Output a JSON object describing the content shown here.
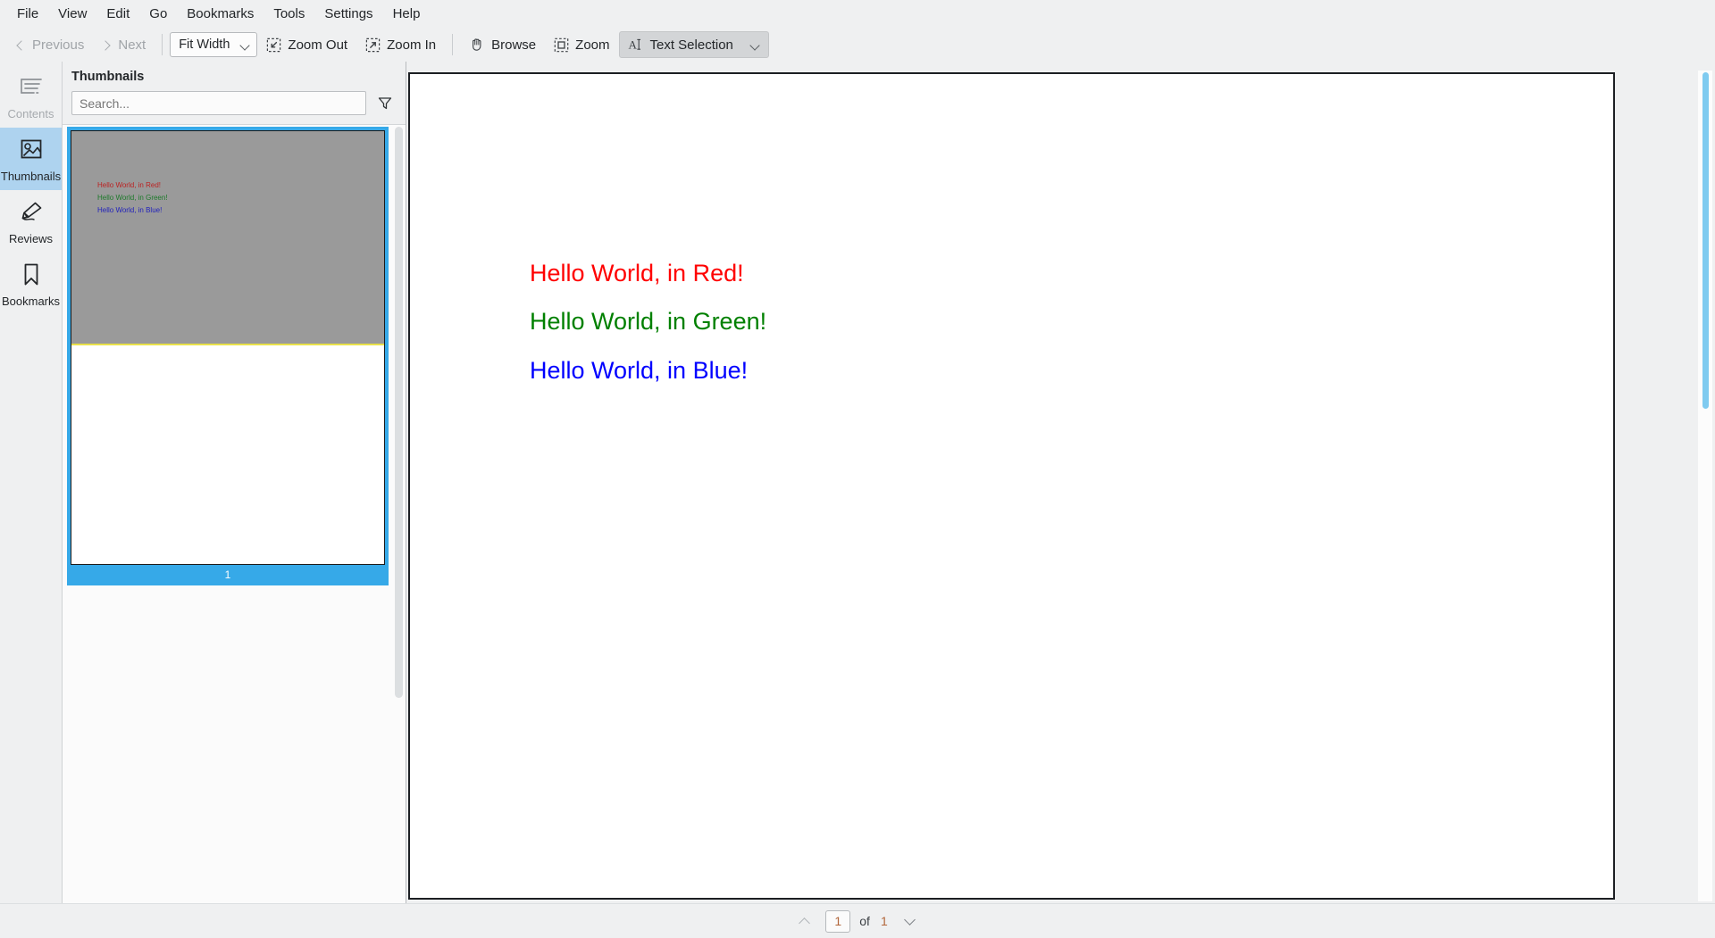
{
  "menubar": {
    "items": [
      {
        "label": "File"
      },
      {
        "label": "View"
      },
      {
        "label": "Edit"
      },
      {
        "label": "Go"
      },
      {
        "label": "Bookmarks"
      },
      {
        "label": "Tools"
      },
      {
        "label": "Settings"
      },
      {
        "label": "Help"
      }
    ]
  },
  "toolbar": {
    "previous_label": "Previous",
    "next_label": "Next",
    "zoom_mode_value": "Fit Width",
    "zoom_out_label": "Zoom Out",
    "zoom_in_label": "Zoom In",
    "browse_label": "Browse",
    "zoom_label": "Zoom",
    "text_selection_label": "Text Selection"
  },
  "rail": {
    "items": [
      {
        "label": "Contents",
        "icon": "contents-icon",
        "state": "disabled"
      },
      {
        "label": "Thumbnails",
        "icon": "thumbnails-icon",
        "state": "selected"
      },
      {
        "label": "Reviews",
        "icon": "reviews-icon",
        "state": "normal"
      },
      {
        "label": "Bookmarks",
        "icon": "bookmarks-icon",
        "state": "normal"
      }
    ]
  },
  "thumbnails_panel": {
    "title": "Thumbnails",
    "search_placeholder": "Search...",
    "search_value": "",
    "filter_icon": "filter-funnel-icon",
    "pages": [
      {
        "number": "1",
        "selected": true,
        "lines": [
          {
            "text": "Hello World, in Red!",
            "color": "#bb2222"
          },
          {
            "text": "Hello World, in Green!",
            "color": "#1d7a2a"
          },
          {
            "text": "Hello World, in Blue!",
            "color": "#2222bb"
          }
        ]
      }
    ]
  },
  "document": {
    "lines": [
      {
        "text": "Hello World, in Red!",
        "color": "#ff0000"
      },
      {
        "text": "Hello World, in Green!",
        "color": "#008000"
      },
      {
        "text": "Hello World, in Blue!",
        "color": "#0000ff"
      }
    ]
  },
  "statusbar": {
    "current_page": "1",
    "of_label": "of",
    "total_pages": "1",
    "prev_page_icon": "chevron-up-icon",
    "next_page_icon": "chevron-down-icon"
  },
  "colors": {
    "selection_blue": "#36a9e8",
    "rail_selected": "#aed3ef",
    "panel_bg": "#eff0f1",
    "thumb_overlay_gray": "#9a9a9a",
    "thumb_overlay_border": "#e9e14a",
    "scroll_thumb_blue": "#7fcbf0"
  }
}
